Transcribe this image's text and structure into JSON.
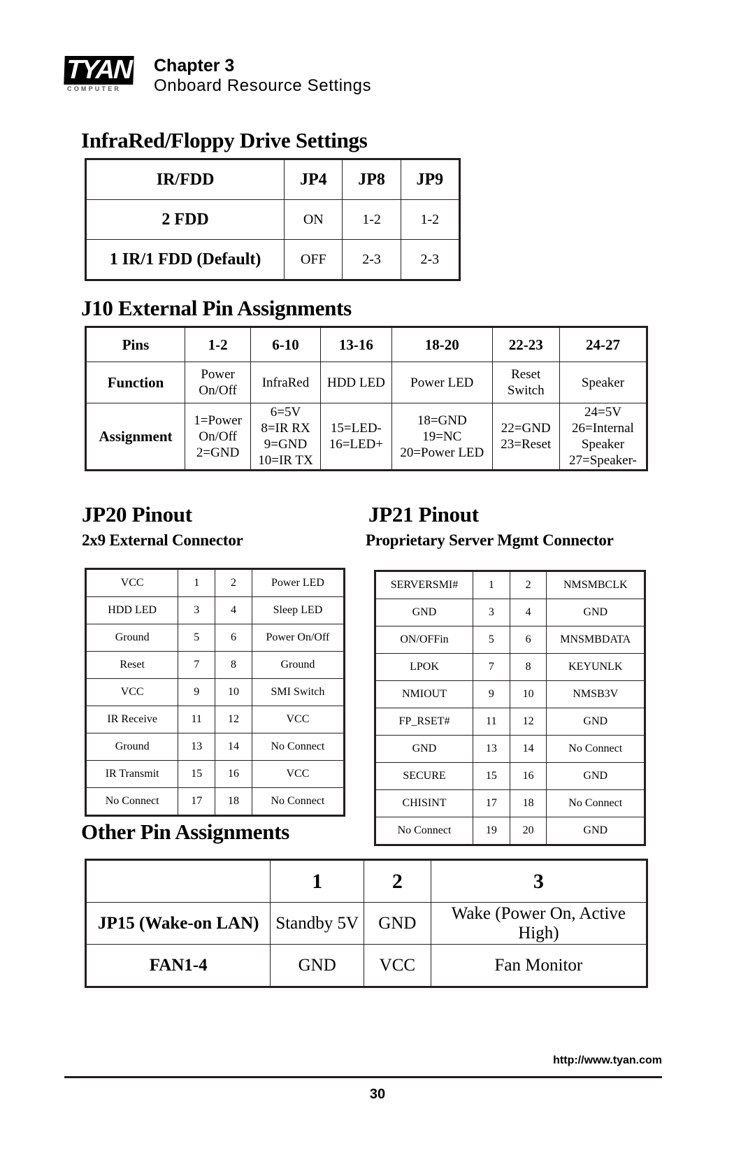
{
  "header": {
    "logo_word": "TYAN",
    "logo_sub": "COMPUTER",
    "chapter": "Chapter 3",
    "subtitle": "Onboard  Resource  Settings"
  },
  "sections": {
    "irfdd_title": "InfraRed/Floppy Drive Settings",
    "j10_title": "J10 External Pin Assignments",
    "jp20_title": "JP20 Pinout",
    "jp20_subtitle": "2x9 External Connector",
    "jp21_title": "JP21 Pinout",
    "jp21_subtitle": "Proprietary Server Mgmt Connector",
    "other_title": "Other Pin Assignments"
  },
  "irfdd_table": {
    "headers": [
      "IR/FDD",
      "JP4",
      "JP8",
      "JP9"
    ],
    "rows": [
      [
        "2 FDD",
        "ON",
        "1-2",
        "1-2"
      ],
      [
        "1 IR/1 FDD (Default)",
        "OFF",
        "2-3",
        "2-3"
      ]
    ]
  },
  "j10_table": {
    "header": [
      "Pins",
      "1-2",
      "6-10",
      "13-16",
      "18-20",
      "22-23",
      "24-27"
    ],
    "function_row": {
      "label": "Function",
      "values": [
        "Power\nOn/Off",
        "InfraRed",
        "HDD LED",
        "Power LED",
        "Reset\nSwitch",
        "Speaker"
      ]
    },
    "assignment_row": {
      "label": "Assignment",
      "values": [
        "1=Power\nOn/Off\n2=GND",
        "6=5V\n8=IR RX\n9=GND\n10=IR TX",
        "15=LED-\n16=LED+",
        "18=GND\n19=NC\n20=Power LED",
        "22=GND\n23=Reset",
        "24=5V\n26=Internal\nSpeaker\n27=Speaker-"
      ]
    }
  },
  "jp20_table": {
    "rows": [
      [
        "VCC",
        "1",
        "2",
        "Power LED"
      ],
      [
        "HDD LED",
        "3",
        "4",
        "Sleep LED"
      ],
      [
        "Ground",
        "5",
        "6",
        "Power On/Off"
      ],
      [
        "Reset",
        "7",
        "8",
        "Ground"
      ],
      [
        "VCC",
        "9",
        "10",
        "SMI Switch"
      ],
      [
        "IR Receive",
        "11",
        "12",
        "VCC"
      ],
      [
        "Ground",
        "13",
        "14",
        "No Connect"
      ],
      [
        "IR Transmit",
        "15",
        "16",
        "VCC"
      ],
      [
        "No Connect",
        "17",
        "18",
        "No Connect"
      ]
    ]
  },
  "jp21_table": {
    "rows": [
      [
        "SERVERSMI#",
        "1",
        "2",
        "NMSMBCLK"
      ],
      [
        "GND",
        "3",
        "4",
        "GND"
      ],
      [
        "ON/OFFin",
        "5",
        "6",
        "MNSMBDATA"
      ],
      [
        "LPOK",
        "7",
        "8",
        "KEYUNLK"
      ],
      [
        "NMIOUT",
        "9",
        "10",
        "NMSB3V"
      ],
      [
        "FP_RSET#",
        "11",
        "12",
        "GND"
      ],
      [
        "GND",
        "13",
        "14",
        "No Connect"
      ],
      [
        "SECURE",
        "15",
        "16",
        "GND"
      ],
      [
        "CHISINT",
        "17",
        "18",
        "No Connect"
      ],
      [
        "No Connect",
        "19",
        "20",
        "GND"
      ]
    ]
  },
  "other_table": {
    "header": [
      "",
      "1",
      "2",
      "3"
    ],
    "rows": [
      [
        "JP15 (Wake-on LAN)",
        "Standby 5V",
        "GND",
        "Wake (Power On, Active High)"
      ],
      [
        "FAN1-4",
        "GND",
        "VCC",
        "Fan Monitor"
      ]
    ]
  },
  "footer": {
    "url": "http://www.tyan.com",
    "page_number": "30"
  }
}
